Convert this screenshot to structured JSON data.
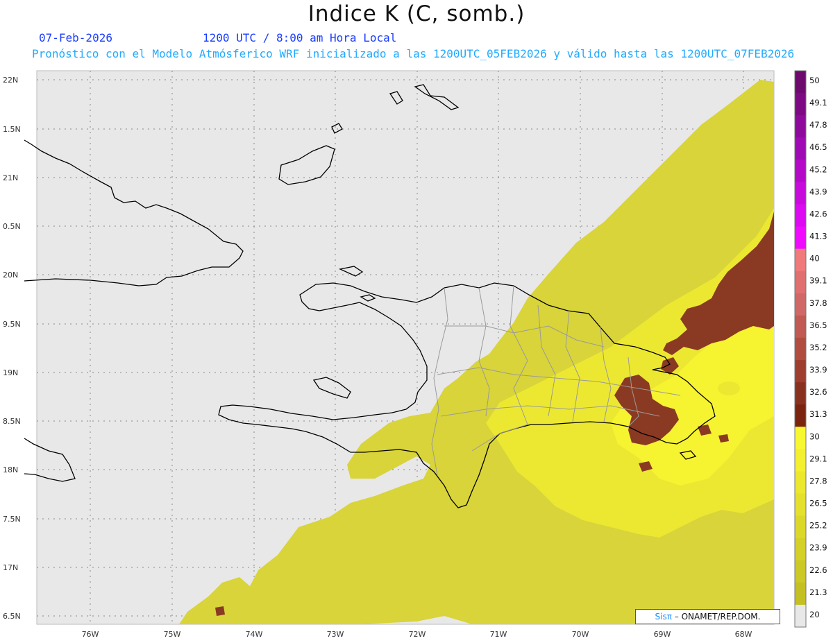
{
  "title": "Indice K (C, somb.)",
  "date_label": "07-Feb-2026",
  "time_label": "1200 UTC / 8:00 am Hora Local",
  "forecast_label": "Pronóstico con el Modelo Atmósferico WRF inicializado a las 1200UTC_05FEB2026 y válido hasta las  1200UTC_07FEB2026",
  "credit": {
    "logo": "Sisπ",
    "text": " – ONAMET/REP.DOM."
  },
  "map": {
    "lat_labels": [
      "22N",
      "1.5N",
      "21N",
      "0.5N",
      "20N",
      "9.5N",
      "19N",
      "8.5N",
      "18N",
      "7.5N",
      "17N",
      "6.5N"
    ],
    "lon_labels": [
      "76W",
      "75W",
      "74W",
      "73W",
      "72W",
      "71W",
      "70W",
      "69W",
      "68W"
    ]
  },
  "colorbar": {
    "labels": [
      "50",
      "49.1",
      "47.8",
      "46.5",
      "45.2",
      "43.9",
      "42.6",
      "41.3",
      "40",
      "39.1",
      "37.8",
      "36.5",
      "35.2",
      "33.9",
      "32.6",
      "31.3",
      "30",
      "29.1",
      "27.8",
      "26.5",
      "25.2",
      "23.9",
      "22.6",
      "21.3",
      "20"
    ],
    "colors": [
      "#6e0a6e",
      "#7d0a84",
      "#8e0a9c",
      "#a00ab4",
      "#b40ac8",
      "#c80adc",
      "#dc0af0",
      "#f00aff",
      "#f07a7a",
      "#e07070",
      "#d06868",
      "#c05a52",
      "#b04c40",
      "#9e3e30",
      "#8a3020",
      "#7a2410",
      "#f8f830",
      "#f4f030",
      "#ece82e",
      "#e4e02c",
      "#dcd82a",
      "#d4d028",
      "#ccc826",
      "#c4c024",
      "#e8e8e8"
    ]
  },
  "colors": {
    "background": "#e8e8e8",
    "dominican_fill": "#d8d43a",
    "yellow_bright": "#f2ef30",
    "yellow_mid": "#dcd82e",
    "brown": "#8a3a22",
    "coast": "#000000",
    "boundaries": "#9a9a9a"
  }
}
